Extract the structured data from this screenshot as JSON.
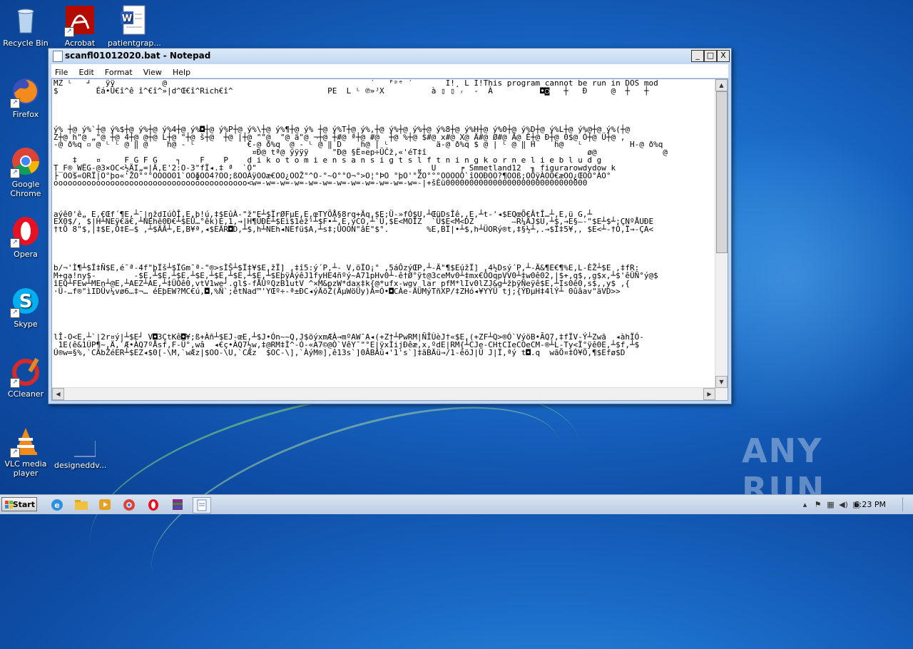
{
  "desktop_icons": [
    {
      "label": "Recycle Bin"
    },
    {
      "label": "Acrobat"
    },
    {
      "label": "patientgrap..."
    },
    {
      "label": "Firefox"
    },
    {
      "label": "Google Chrome"
    },
    {
      "label": "Opera"
    },
    {
      "label": "Skype"
    },
    {
      "label": "CCleaner"
    },
    {
      "label": "VLC media player"
    },
    {
      "label": "designeddv..."
    }
  ],
  "window": {
    "title": "scanfl01012020.bat - Notepad",
    "menu": [
      "File",
      "Edit",
      "Format",
      "View",
      "Help"
    ],
    "buttons": {
      "minimize": "_",
      "maximize": "□",
      "close": "X"
    },
    "lines": [
      "MZ ᴸ   ┘   ÿÿ          @                                           ´   ᴾᵖᵉ ´       Í!¸ L Í!This program cannot be run in DOS mod",
      "$        Éá•Û€î^ê î^€î^»|d^Œ€î^Rich€î^                    PE  L ᴸ ℗»ᴶX          à ▯ ▯ ᵣ  -  À          ◘◙   ┼   Ð     @  ┼   ┼",
      "",
      "",
      "",
      "",
      "ý% ┼@ ý%`┼@ ý%$┼@ ý%┼@ ý%4┼@ ý%◘┼@ ý%P┼@ ý%\\┼@ ý%¶┼@ ý% ┼@ ý%T┼@ ý%,┼@ ý%┼@ ý%┼@ ý%8┼@ ý%H┼@ ý%0┼@ ý%D┼@ ý%L┼@ ý%@┼@ ý%(┼@",
      "Z┼@ h\"@ „\"@ ┼@ 4┼@ @┼@ L┼@ \"┼@ š┼@  ┼@ |┼@ \"\"@  \"@ ä\"@ ¬┼@ ┼#@ ª┼@ #@  ┼@ %┼@ $#@ x#@ X@ Ä#@ Ø#@ Ä@ Ê┼@ Ð┼@ 0$@ Ó┼@ Ü┼@ ,",
      "-@ ð%q ▫ @ ᴸ ᴸ @ ‖ @    h@ - ᴸ           €-@ ð%q  @ - ᴸ @ ‖ D    h@ | ᴸ          ä-@ ð%q $ @ | ᴸ @ ‖ H    h@   ᴸ          H-@ ð%q",
      "                                          ¤Ð@ tª@ ÿÿÿÿ     \"Ð@ §Ë¤ep÷ÜČž‚«'éT‡î                                  ø@              @",
      "    ‡    ¤     F G F G    ┐    F    P    d i k o t o m i e n s a n s i g t s l f t n i n g k o r n e l i e b l u d g",
      "T_F®_WËG-@3×OC<½ÄI„=|Ä‚E'2:O-3\"fÏ◂.‡ ª  `Ó\"                                  „  U     ╒ Smmetland12  ╖ figurarowdydow k",
      "├ OO$«ORÏ|O°þo«'ŽO°°°OOOOO1`OOɸOO4?OO;ßOOÀÿOOæ€OO¿OOŽ°^O-°~O°°O¬°>O¦°ÞO °þO'°ŽO°°°OOOOO`îOOÐOO?¶OOß;OOÿÀOO€æOO¿ŒOO°ÀO°",
      "ooooooooooooooooooooooooooooooooooooooooo<w=-w=-w=-w=-w=-w=-w=-w=-w=-w=-w=-w=-|+šÈü000000000000000000000000000000",
      "",
      "",
      "",
      "aýê0'ê„ E‚€Œf´¶E‚┴¯|ŋždIúÒÎ‚E‚þ!ú‚‡$EûÀ-\"ž\"E┴$ÏrØFµE‚E‚œTYÖÅ§8rq+Äq‚$E;Ü-»fÓ$U‚┴ŒüDsÎê‚‚E‚┴t-'◂$EQœÕ€ÂtÎ…┴‚E‚ü G‚┴",
      "EX0$/‚ $|H┴NEÿ€ä€‚┴NEhê0Ð€┴$EÜ…°êk)E‚1‚→|H¶ÛÐÈ┴$Eì$1èž¹┴$F•┴‚E‚ýCO‚┴`Ü‚$E<MOÏZ  `Ü$E<M<DZ        –R¼ÄJ$U‚┴$‚→E§–-\"$E┴$┴;ÇNºÅUÐE",
      "†tÕ 8\"$‚|‡$E‚Ó‡E–$ ‚┴$ÄÂ┴‚E‚B¥ª‚◂$EÄR◘D‚┴$‚h┴NEh◂NEfü$A‚┴s‡;ÜOON\"âE\"$°.        %E‚BÏ|•┴$‚h┴ÜORý®t‚‡§½┴‚.→$Ï‡5¥‚‚ $E<┴-†Ó‚Ï→-ÇA<",
      "",
      "",
      "",
      "",
      "b/¬'Ì¶┴$Ï‡Ñ$E‚é¯ª-4f\"þÏš┴$ÏGm¯ª-\"®>sÌŠ┴$Ï‡¥$E‚žÏ] ‚‡î5:ý´P‚┴- V‚öÏO¡° ‚5áÔzýŒP‚┴-Ä\"¶$EúžÏ] ‚4½Dsý´P‚┴-Ä&¶E€¶%E‚L-ÈŽ┴$E ‚‡fR:",
      "M+ga!ny$-        -$E‚┴$E‚┴$E‚┴$E‚┴$E‚┴$E‚┴$E‚┴$EþÿÁýêJ1fyHE4ñºý~A71pHv0┴-ê†Ø°ÿt@3ceMv0┴‡mx€ÔOqpVV0┴‡w0ê02‚|$+‚q$‚‚g$x‚┴$'êÛÑ°ý@$",
      "îEQ┴FEw┴MEn┴@E‚┴AEZ┴AE‚┴‡ÜÒê0‚vtV1we┘.gl$-fÅÛºQzB1utV ^×M&pzW*dax‡k{@*ufx-wgv lar pfM*lIv0lZJ&g┴žþÿÑeÿê$E‚┴Is0ê0‚s$‚‚y$ ‚{",
      "·Ü-…f®\"ìIDÜv¼vø6…‡¬… éEþEW?MC€ú‚◘‚%Ñ`;êtNad™'YŒº÷-ª±ÐC◂ýÄöŽ(ÄµWöÜy)Â=Ó•◘CÀe-ÄÜMýTñXP/‡ZHó◂¥YÝÜ tj;{ÝÐµH‡4lÝ┴ 0ûâav\"äVD>>",
      "",
      "",
      "",
      "",
      "",
      "lÎ-O<E‚┴`|2r¤ý|┴$E┘ V◘3ÇtKê◘¥;ß+Àñ┴$EJ-œE‚┴$J•Ón~~Q‚J$öýxmÆÀ→mºAW¯A◂(+Z†┴PwRM|ÑÎÙèJ†«$E‚(+ZF┴Q>®Ó`VýöB•ÃQ7‚‡fÏV-Ý┴Zwã  ◂àhÏÓ-",
      " 1E(ê&1ÚP¶~‚Ä‚`Æ•ÀQ7ºÅsf‚F-Ü°‚wâ  ◂€ç•ÀQ7½w‚‡@RM‡Ì^-Ó-«A7©@Ò`VêY¯\"°E|ÿxÌijÐêæ‚x‚ºdE|RM{┴CJe-CHtCIeCOeCM-®┴L-Ty<Ï°ÿê0E‚┴$f‚┴$",
      "Ú®w=§%‚`CÄbŽéER┴$EZ◂$0[-\\M‚`wÆz|$OO-\\U‚`CÆz  $OC-\\]‚`ÀýM®],ê13s`]0ÂBÀü◂'1's`]‡ãBÄü→/1-êöJ|Ü J|Ï‚ªý t◘.q  wãÕ¤‡Ó¥Ö‚¶$Efø$D"
    ]
  },
  "taskbar": {
    "start_label": "Start",
    "apps": [
      "internet-explorer",
      "windows-explorer",
      "media-player",
      "chrome",
      "opera",
      "winrar",
      "notepad"
    ],
    "clock": "6:23 PM"
  },
  "watermark": "ANY RUN"
}
